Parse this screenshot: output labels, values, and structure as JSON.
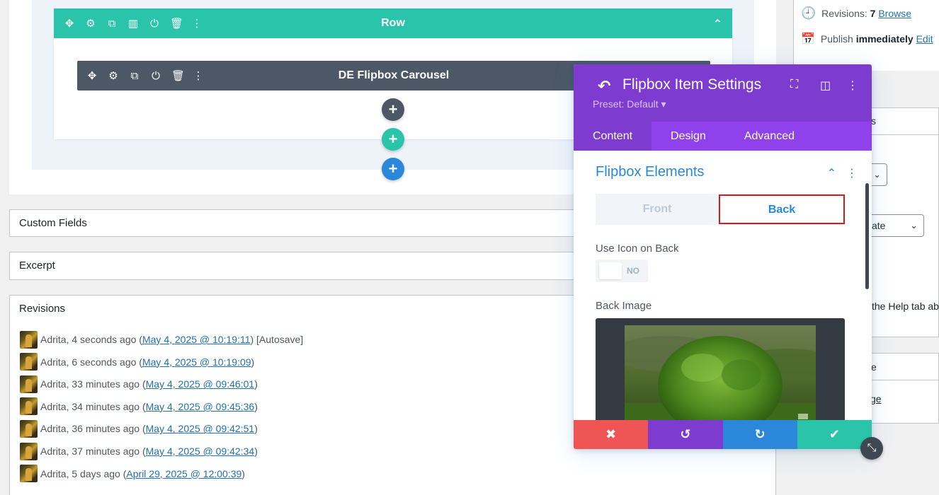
{
  "builder": {
    "row": {
      "title": "Row",
      "tools": [
        {
          "name": "move-icon",
          "glyph": "✥"
        },
        {
          "name": "gear-icon",
          "glyph": "⚙"
        },
        {
          "name": "duplicate-icon",
          "glyph": "⧉"
        },
        {
          "name": "columns-icon",
          "glyph": "▥"
        },
        {
          "name": "power-icon",
          "glyph": "⏻"
        },
        {
          "name": "trash-icon",
          "glyph": "🗑"
        },
        {
          "name": "more-icon",
          "glyph": "⋮"
        }
      ],
      "collapse_glyph": "⌃"
    },
    "module": {
      "title": "DE Flipbox Carousel",
      "tools": [
        {
          "name": "move-icon",
          "glyph": "✥"
        },
        {
          "name": "gear-icon",
          "glyph": "⚙"
        },
        {
          "name": "duplicate-icon",
          "glyph": "⧉"
        },
        {
          "name": "power-icon",
          "glyph": "⏻"
        },
        {
          "name": "trash-icon",
          "glyph": "🗑"
        },
        {
          "name": "more-icon",
          "glyph": "⋮"
        }
      ]
    },
    "add_buttons": [
      {
        "name": "add-module-button",
        "glyph": "+",
        "color": "#4c5866"
      },
      {
        "name": "add-row-button",
        "glyph": "+",
        "color": "#29c4a9"
      },
      {
        "name": "add-section-button",
        "glyph": "+",
        "color": "#2b87da"
      }
    ]
  },
  "metaboxes": {
    "custom_fields": "Custom Fields",
    "excerpt": "Excerpt",
    "revisions": "Revisions"
  },
  "revisions": [
    {
      "author": "Adrita",
      "ago": "4 seconds ago",
      "date": "May 4, 2025 @ 10:19:11",
      "suffix": " [Autosave]"
    },
    {
      "author": "Adrita",
      "ago": "6 seconds ago",
      "date": "May 4, 2025 @ 10:19:09",
      "suffix": ""
    },
    {
      "author": "Adrita",
      "ago": "33 minutes ago",
      "date": "May 4, 2025 @ 09:46:01",
      "suffix": ""
    },
    {
      "author": "Adrita",
      "ago": "34 minutes ago",
      "date": "May 4, 2025 @ 09:45:36",
      "suffix": ""
    },
    {
      "author": "Adrita",
      "ago": "36 minutes ago",
      "date": "May 4, 2025 @ 09:42:51",
      "suffix": ""
    },
    {
      "author": "Adrita",
      "ago": "37 minutes ago",
      "date": "May 4, 2025 @ 09:42:34",
      "suffix": ""
    },
    {
      "author": "Adrita",
      "ago": "5 days ago",
      "date": "April 29, 2025 @ 12:00:39",
      "suffix": ""
    }
  ],
  "sidebar": {
    "revisions_label": "Revisions:",
    "revisions_count": "7",
    "revisions_link": "Browse",
    "publish_label": "Publish",
    "publish_value": "immediately",
    "publish_link": "Edit",
    "frag_s": "s",
    "frag_ate": "ate",
    "frag_help": "the Help tab ab",
    "frag_e": "e",
    "frag_ge": "ge"
  },
  "modal": {
    "title": "Flipbox Item Settings",
    "preset": "Preset: Default ▾",
    "tabs": [
      "Content",
      "Design",
      "Advanced"
    ],
    "active_tab": 0,
    "section_title": "Flipbox Elements",
    "switcher": {
      "front": "Front",
      "back": "Back",
      "active": "back"
    },
    "use_icon_label": "Use Icon on Back",
    "toggle_value": "NO",
    "back_image_label": "Back Image"
  },
  "colors": {
    "row_teal": "#29c4a9",
    "module_gray": "#4c5866",
    "modal_purple": "#7e3bd0",
    "tab_purple": "#8f42ec",
    "accent_blue": "#2b87da",
    "cancel_red": "#ef5555",
    "undo_purple": "#7e3bd0",
    "redo_blue": "#2b87da",
    "save_teal": "#29c4a9",
    "highlight_red": "#d51b1b"
  }
}
